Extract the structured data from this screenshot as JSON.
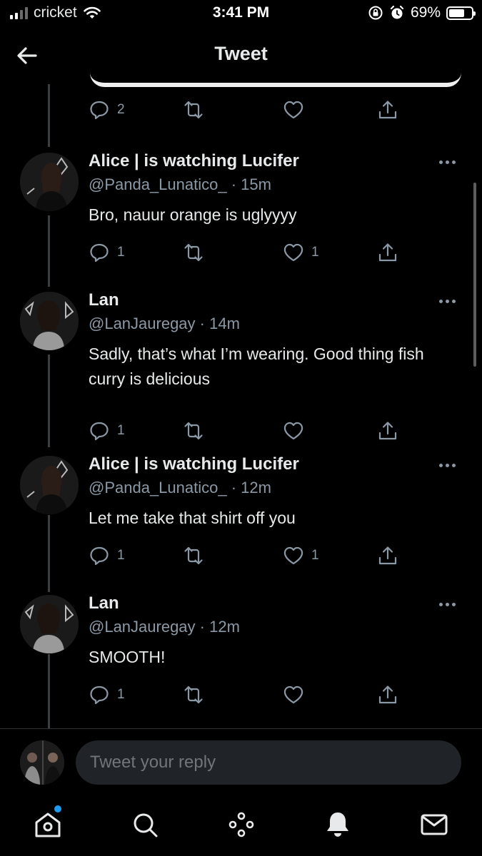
{
  "status_bar": {
    "carrier": "cricket",
    "time": "3:41 PM",
    "battery_percent": "69%",
    "battery_level": 0.69
  },
  "header": {
    "title": "Tweet"
  },
  "top_actions": {
    "reply_count": "2",
    "retweet_count": "",
    "like_count": ""
  },
  "tweets": [
    {
      "name": "Alice | is watching Lucifer",
      "handle": "@Panda_Lunatico_",
      "time": "15m",
      "text": "Bro, nauur orange is uglyyyy",
      "reply_count": "1",
      "like_count": "1"
    },
    {
      "name": "Lan",
      "handle": "@LanJauregay",
      "time": "14m",
      "text": "Sadly, that’s what I’m wearing. Good thing fish curry is delicious",
      "reply_count": "1",
      "like_count": ""
    },
    {
      "name": "Alice | is watching Lucifer",
      "handle": "@Panda_Lunatico_",
      "time": "12m",
      "text": "Let me take that shirt off you",
      "reply_count": "1",
      "like_count": "1"
    },
    {
      "name": "Lan",
      "handle": "@LanJauregay",
      "time": "12m",
      "text": "SMOOTH!",
      "reply_count": "1",
      "like_count": ""
    }
  ],
  "reply_bar": {
    "placeholder": "Tweet your reply"
  },
  "colors": {
    "background": "#000000",
    "text_primary": "#e7e9ea",
    "text_secondary": "#8b98a5",
    "accent": "#1d9bf0"
  }
}
